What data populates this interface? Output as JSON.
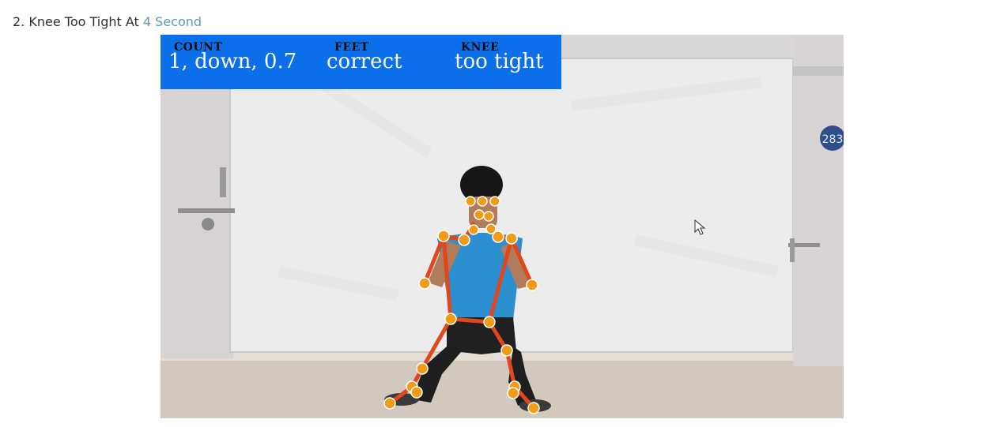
{
  "caption": {
    "prefix": "2. Knee Too Tight At ",
    "highlight": "4 Second"
  },
  "overlay": {
    "count_label": "COUNT",
    "count_value": "1, down, 0.7",
    "feet_label": "FEET",
    "feet_value": "correct",
    "knee_label": "KNEE",
    "knee_value": "too tight"
  },
  "scene": {
    "wall_number": "283"
  },
  "colors": {
    "overlay_bg": "#0a6fe8",
    "skeleton_line": "#e2461d",
    "keypoint_fill": "#f39a16",
    "caption_highlight": "#5d9ab2"
  }
}
